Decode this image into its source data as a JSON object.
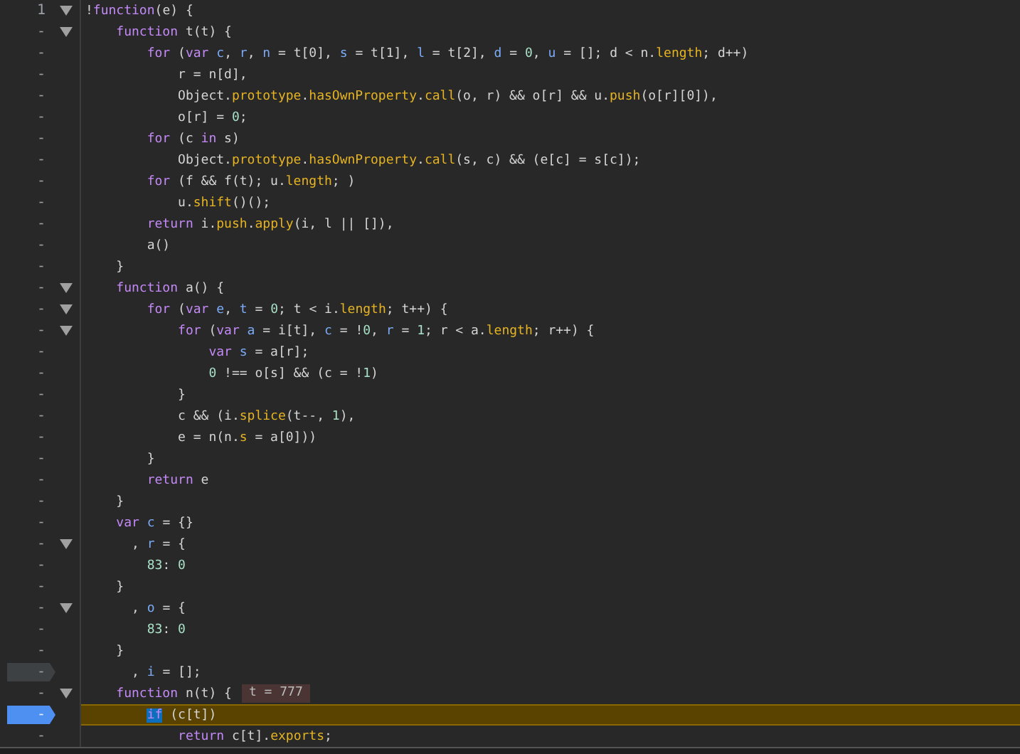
{
  "lines": [
    {
      "gutter": "1",
      "fold": true,
      "kind": "plain",
      "current": false,
      "tokens": [
        {
          "kind": "txt",
          "text": "!"
        },
        {
          "kind": "kw",
          "text": "function"
        },
        {
          "kind": "txt",
          "text": "(e) {"
        }
      ]
    },
    {
      "gutter": "-",
      "fold": true,
      "kind": "plain",
      "current": false,
      "tokens": [
        {
          "kind": "kw",
          "text": "    function"
        },
        {
          "kind": "txt",
          "text": " t(t) {"
        }
      ]
    },
    {
      "gutter": "-",
      "fold": false,
      "kind": "plain",
      "current": false,
      "tokens": [
        {
          "kind": "kw",
          "text": "        for"
        },
        {
          "kind": "txt",
          "text": " ("
        },
        {
          "kind": "kw",
          "text": "var"
        },
        {
          "kind": "def",
          "text": " c"
        },
        {
          "kind": "txt",
          "text": ", "
        },
        {
          "kind": "def",
          "text": "r"
        },
        {
          "kind": "txt",
          "text": ", "
        },
        {
          "kind": "def",
          "text": "n"
        },
        {
          "kind": "txt",
          "text": " = t[0], "
        },
        {
          "kind": "def",
          "text": "s"
        },
        {
          "kind": "txt",
          "text": " = t[1], "
        },
        {
          "kind": "def",
          "text": "l"
        },
        {
          "kind": "txt",
          "text": " = t[2], "
        },
        {
          "kind": "def",
          "text": "d"
        },
        {
          "kind": "txt",
          "text": " = "
        },
        {
          "kind": "num",
          "text": "0"
        },
        {
          "kind": "txt",
          "text": ", "
        },
        {
          "kind": "def",
          "text": "u"
        },
        {
          "kind": "txt",
          "text": " = []; d < n."
        },
        {
          "kind": "prop",
          "text": "length"
        },
        {
          "kind": "txt",
          "text": "; d++)"
        }
      ]
    },
    {
      "gutter": "-",
      "fold": false,
      "kind": "plain",
      "current": false,
      "tokens": [
        {
          "kind": "txt",
          "text": "            r = n[d],"
        }
      ]
    },
    {
      "gutter": "-",
      "fold": false,
      "kind": "plain",
      "current": false,
      "tokens": [
        {
          "kind": "txt",
          "text": "            Object."
        },
        {
          "kind": "prop",
          "text": "prototype"
        },
        {
          "kind": "txt",
          "text": "."
        },
        {
          "kind": "prop",
          "text": "hasOwnProperty"
        },
        {
          "kind": "txt",
          "text": "."
        },
        {
          "kind": "prop",
          "text": "call"
        },
        {
          "kind": "txt",
          "text": "(o, r) && o[r] && u."
        },
        {
          "kind": "prop",
          "text": "push"
        },
        {
          "kind": "txt",
          "text": "(o[r][0]),"
        }
      ]
    },
    {
      "gutter": "-",
      "fold": false,
      "kind": "plain",
      "current": false,
      "tokens": [
        {
          "kind": "txt",
          "text": "            o[r] = "
        },
        {
          "kind": "num",
          "text": "0"
        },
        {
          "kind": "txt",
          "text": ";"
        }
      ]
    },
    {
      "gutter": "-",
      "fold": false,
      "kind": "plain",
      "current": false,
      "tokens": [
        {
          "kind": "kw",
          "text": "        for"
        },
        {
          "kind": "txt",
          "text": " (c "
        },
        {
          "kind": "kw",
          "text": "in"
        },
        {
          "kind": "txt",
          "text": " s)"
        }
      ]
    },
    {
      "gutter": "-",
      "fold": false,
      "kind": "plain",
      "current": false,
      "tokens": [
        {
          "kind": "txt",
          "text": "            Object."
        },
        {
          "kind": "prop",
          "text": "prototype"
        },
        {
          "kind": "txt",
          "text": "."
        },
        {
          "kind": "prop",
          "text": "hasOwnProperty"
        },
        {
          "kind": "txt",
          "text": "."
        },
        {
          "kind": "prop",
          "text": "call"
        },
        {
          "kind": "txt",
          "text": "(s, c) && (e[c] = s[c]);"
        }
      ]
    },
    {
      "gutter": "-",
      "fold": false,
      "kind": "plain",
      "current": false,
      "tokens": [
        {
          "kind": "kw",
          "text": "        for"
        },
        {
          "kind": "txt",
          "text": " (f && f(t); u."
        },
        {
          "kind": "prop",
          "text": "length"
        },
        {
          "kind": "txt",
          "text": "; )"
        }
      ]
    },
    {
      "gutter": "-",
      "fold": false,
      "kind": "plain",
      "current": false,
      "tokens": [
        {
          "kind": "txt",
          "text": "            u."
        },
        {
          "kind": "prop",
          "text": "shift"
        },
        {
          "kind": "txt",
          "text": "()();"
        }
      ]
    },
    {
      "gutter": "-",
      "fold": false,
      "kind": "plain",
      "current": false,
      "tokens": [
        {
          "kind": "kw",
          "text": "        return"
        },
        {
          "kind": "txt",
          "text": " i."
        },
        {
          "kind": "prop",
          "text": "push"
        },
        {
          "kind": "txt",
          "text": "."
        },
        {
          "kind": "prop",
          "text": "apply"
        },
        {
          "kind": "txt",
          "text": "(i, l || []),"
        }
      ]
    },
    {
      "gutter": "-",
      "fold": false,
      "kind": "plain",
      "current": false,
      "tokens": [
        {
          "kind": "txt",
          "text": "        a()"
        }
      ]
    },
    {
      "gutter": "-",
      "fold": false,
      "kind": "plain",
      "current": false,
      "tokens": [
        {
          "kind": "txt",
          "text": "    }"
        }
      ]
    },
    {
      "gutter": "-",
      "fold": true,
      "kind": "plain",
      "current": false,
      "tokens": [
        {
          "kind": "kw",
          "text": "    function"
        },
        {
          "kind": "txt",
          "text": " a() {"
        }
      ]
    },
    {
      "gutter": "-",
      "fold": true,
      "kind": "plain",
      "current": false,
      "tokens": [
        {
          "kind": "kw",
          "text": "        for"
        },
        {
          "kind": "txt",
          "text": " ("
        },
        {
          "kind": "kw",
          "text": "var"
        },
        {
          "kind": "def",
          "text": " e"
        },
        {
          "kind": "txt",
          "text": ", "
        },
        {
          "kind": "def",
          "text": "t"
        },
        {
          "kind": "txt",
          "text": " = "
        },
        {
          "kind": "num",
          "text": "0"
        },
        {
          "kind": "txt",
          "text": "; t < i."
        },
        {
          "kind": "prop",
          "text": "length"
        },
        {
          "kind": "txt",
          "text": "; t++) {"
        }
      ]
    },
    {
      "gutter": "-",
      "fold": true,
      "kind": "plain",
      "current": false,
      "tokens": [
        {
          "kind": "kw",
          "text": "            for"
        },
        {
          "kind": "txt",
          "text": " ("
        },
        {
          "kind": "kw",
          "text": "var"
        },
        {
          "kind": "def",
          "text": " a"
        },
        {
          "kind": "txt",
          "text": " = i[t], "
        },
        {
          "kind": "def",
          "text": "c"
        },
        {
          "kind": "txt",
          "text": " = !"
        },
        {
          "kind": "num",
          "text": "0"
        },
        {
          "kind": "txt",
          "text": ", "
        },
        {
          "kind": "def",
          "text": "r"
        },
        {
          "kind": "txt",
          "text": " = "
        },
        {
          "kind": "num",
          "text": "1"
        },
        {
          "kind": "txt",
          "text": "; r < a."
        },
        {
          "kind": "prop",
          "text": "length"
        },
        {
          "kind": "txt",
          "text": "; r++) {"
        }
      ]
    },
    {
      "gutter": "-",
      "fold": false,
      "kind": "plain",
      "current": false,
      "tokens": [
        {
          "kind": "kw",
          "text": "                var"
        },
        {
          "kind": "def",
          "text": " s"
        },
        {
          "kind": "txt",
          "text": " = a[r];"
        }
      ]
    },
    {
      "gutter": "-",
      "fold": false,
      "kind": "plain",
      "current": false,
      "tokens": [
        {
          "kind": "num",
          "text": "                0"
        },
        {
          "kind": "txt",
          "text": " !== o[s] && (c = !"
        },
        {
          "kind": "num",
          "text": "1"
        },
        {
          "kind": "txt",
          "text": ")"
        }
      ]
    },
    {
      "gutter": "-",
      "fold": false,
      "kind": "plain",
      "current": false,
      "tokens": [
        {
          "kind": "txt",
          "text": "            }"
        }
      ]
    },
    {
      "gutter": "-",
      "fold": false,
      "kind": "plain",
      "current": false,
      "tokens": [
        {
          "kind": "txt",
          "text": "            c && (i."
        },
        {
          "kind": "prop",
          "text": "splice"
        },
        {
          "kind": "txt",
          "text": "(t--, "
        },
        {
          "kind": "num",
          "text": "1"
        },
        {
          "kind": "txt",
          "text": "),"
        }
      ]
    },
    {
      "gutter": "-",
      "fold": false,
      "kind": "plain",
      "current": false,
      "tokens": [
        {
          "kind": "txt",
          "text": "            e = n(n."
        },
        {
          "kind": "prop",
          "text": "s"
        },
        {
          "kind": "txt",
          "text": " = a[0]))"
        }
      ]
    },
    {
      "gutter": "-",
      "fold": false,
      "kind": "plain",
      "current": false,
      "tokens": [
        {
          "kind": "txt",
          "text": "        }"
        }
      ]
    },
    {
      "gutter": "-",
      "fold": false,
      "kind": "plain",
      "current": false,
      "tokens": [
        {
          "kind": "kw",
          "text": "        return"
        },
        {
          "kind": "txt",
          "text": " e"
        }
      ]
    },
    {
      "gutter": "-",
      "fold": false,
      "kind": "plain",
      "current": false,
      "tokens": [
        {
          "kind": "txt",
          "text": "    }"
        }
      ]
    },
    {
      "gutter": "-",
      "fold": false,
      "kind": "plain",
      "current": false,
      "tokens": [
        {
          "kind": "kw",
          "text": "    var"
        },
        {
          "kind": "def",
          "text": " c"
        },
        {
          "kind": "txt",
          "text": " = {}"
        }
      ]
    },
    {
      "gutter": "-",
      "fold": true,
      "kind": "plain",
      "current": false,
      "tokens": [
        {
          "kind": "txt",
          "text": "      , "
        },
        {
          "kind": "def",
          "text": "r"
        },
        {
          "kind": "txt",
          "text": " = {"
        }
      ]
    },
    {
      "gutter": "-",
      "fold": false,
      "kind": "plain",
      "current": false,
      "tokens": [
        {
          "kind": "num",
          "text": "        83"
        },
        {
          "kind": "txt",
          "text": ": "
        },
        {
          "kind": "num",
          "text": "0"
        }
      ]
    },
    {
      "gutter": "-",
      "fold": false,
      "kind": "plain",
      "current": false,
      "tokens": [
        {
          "kind": "txt",
          "text": "    }"
        }
      ]
    },
    {
      "gutter": "-",
      "fold": true,
      "kind": "plain",
      "current": false,
      "tokens": [
        {
          "kind": "txt",
          "text": "      , "
        },
        {
          "kind": "def",
          "text": "o"
        },
        {
          "kind": "txt",
          "text": " = {"
        }
      ]
    },
    {
      "gutter": "-",
      "fold": false,
      "kind": "plain",
      "current": false,
      "tokens": [
        {
          "kind": "num",
          "text": "        83"
        },
        {
          "kind": "txt",
          "text": ": "
        },
        {
          "kind": "num",
          "text": "0"
        }
      ]
    },
    {
      "gutter": "-",
      "fold": false,
      "kind": "plain",
      "current": false,
      "tokens": [
        {
          "kind": "txt",
          "text": "    }"
        }
      ]
    },
    {
      "gutter": "-",
      "fold": false,
      "kind": "disabled",
      "current": false,
      "tokens": [
        {
          "kind": "txt",
          "text": "      , "
        },
        {
          "kind": "def",
          "text": "i"
        },
        {
          "kind": "txt",
          "text": " = [];"
        }
      ]
    },
    {
      "gutter": "-",
      "fold": true,
      "kind": "plain",
      "current": false,
      "tokens": [
        {
          "kind": "kw",
          "text": "    function"
        },
        {
          "kind": "txt",
          "text": " n(t) {"
        }
      ],
      "inline_value": "t = 777"
    },
    {
      "gutter": "-",
      "fold": false,
      "kind": "breakpoint",
      "current": true,
      "tokens": [
        {
          "kind": "exec",
          "text": "        if"
        },
        {
          "kind": "txt",
          "text": " (c[t])"
        }
      ]
    },
    {
      "gutter": "-",
      "fold": false,
      "kind": "plain",
      "current": false,
      "tokens": [
        {
          "kind": "kw",
          "text": "            return"
        },
        {
          "kind": "txt",
          "text": " c[t]."
        },
        {
          "kind": "prop",
          "text": "exports"
        },
        {
          "kind": "txt",
          "text": ";"
        }
      ]
    }
  ]
}
